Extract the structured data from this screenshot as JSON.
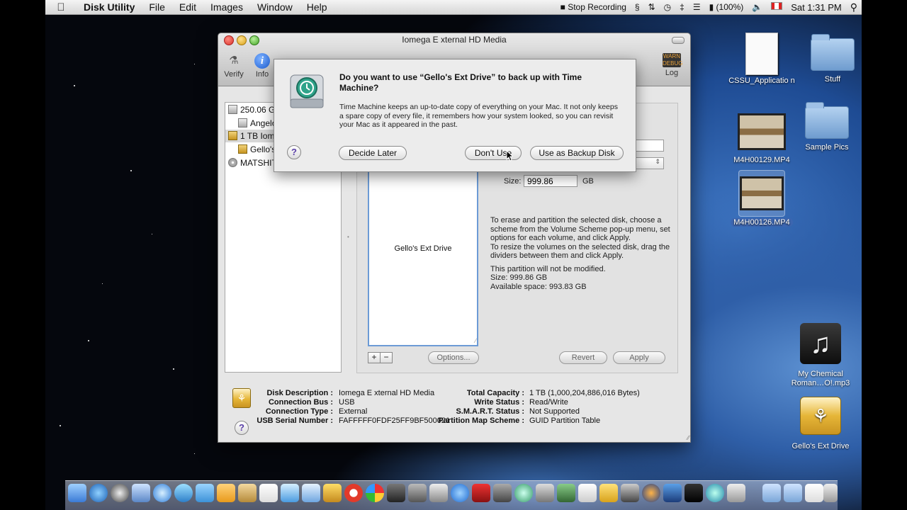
{
  "menubar": {
    "app_name": "Disk Utility",
    "items": [
      "File",
      "Edit",
      "Images",
      "Window",
      "Help"
    ],
    "stop_recording": "Stop Recording",
    "battery": "(100%)",
    "clock": "Sat 1:31 PM"
  },
  "window": {
    "title": "Iomega E xternal HD Media",
    "toolbar": {
      "verify": "Verify",
      "info": "Info",
      "log": "Log"
    },
    "sidebar": {
      "items": [
        "250.06 G",
        "Angelo",
        "1 TB Iome",
        "Gello's",
        "MATSHIT/"
      ]
    },
    "partition": {
      "volume_name": "Gello's Ext Drive",
      "size_label": "Size:",
      "size_value": "999.86",
      "size_unit": "GB",
      "description": "To erase and partition the selected disk, choose a scheme from the Volume Scheme pop-up menu, set options for each volume, and click Apply.\nTo resize the volumes on the selected disk, drag the dividers between them and click Apply.",
      "status_line1": "This partition will not be modified.",
      "status_line2": "Size: 999.86 GB",
      "status_line3": "Available space: 993.83 GB",
      "add_button": "+",
      "remove_button": "−",
      "options_button": "Options...",
      "revert_button": "Revert",
      "apply_button": "Apply"
    },
    "info": {
      "disk_description_label": "Disk Description :",
      "disk_description": "Iomega E xternal HD Media",
      "connection_bus_label": "Connection Bus :",
      "connection_bus": "USB",
      "connection_type_label": "Connection Type :",
      "connection_type": "External",
      "usb_serial_label": "USB Serial Number :",
      "usb_serial": "FAFFFFF0FDF25FF9BF500021",
      "total_capacity_label": "Total Capacity :",
      "total_capacity": "1 TB (1,000,204,886,016 Bytes)",
      "write_status_label": "Write Status :",
      "write_status": "Read/Write",
      "smart_status_label": "S.M.A.R.T. Status :",
      "smart_status": "Not Supported",
      "partition_map_label": "Partition Map Scheme :",
      "partition_map": "GUID Partition Table"
    }
  },
  "dialog": {
    "title": "Do you want to use “Gello's Ext Drive” to back up with Time Machine?",
    "body": "Time Machine keeps an up-to-date copy of everything on your Mac. It not only keeps a spare copy of every file, it remembers how your system looked, so you can revisit your Mac as it appeared in the past.",
    "decide_later": "Decide Later",
    "dont_use": "Don't Use",
    "use_as_backup": "Use as Backup Disk",
    "help": "?"
  },
  "desktop": {
    "icons": [
      {
        "name": "CSSU_Application",
        "label": "CSSU_Applicatio n"
      },
      {
        "name": "Stuff",
        "label": "Stuff"
      },
      {
        "name": "M4H00129.MP4",
        "label": "M4H00129.MP4"
      },
      {
        "name": "Sample Pics",
        "label": "Sample Pics"
      },
      {
        "name": "M4H00126.MP4",
        "label": "M4H00126.MP4"
      },
      {
        "name": "My Chemical Roman...O!.mp3",
        "label": "My Chemical Roman…O!.mp3"
      },
      {
        "name": "Gello's Ext Drive",
        "label": "Gello's Ext Drive"
      }
    ]
  },
  "colors": {
    "selection_blue": "#3d66b0",
    "partition_border": "#6c9bd6"
  }
}
